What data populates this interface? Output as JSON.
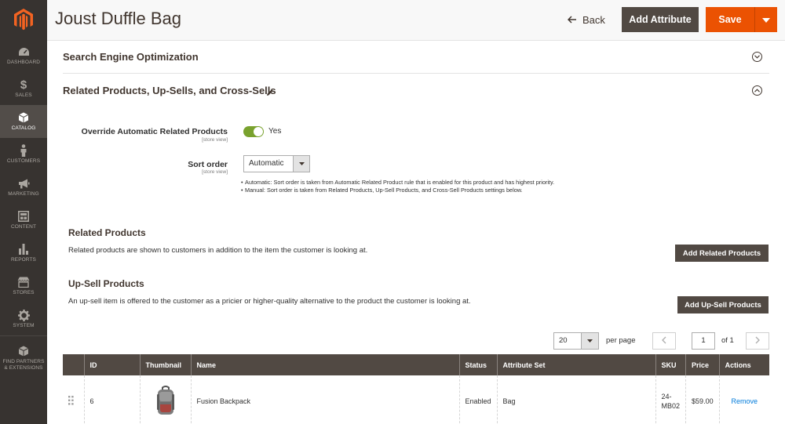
{
  "sidebar": {
    "items": [
      {
        "label": "DASHBOARD",
        "icon": "dashboard-icon"
      },
      {
        "label": "SALES",
        "icon": "dollar-icon"
      },
      {
        "label": "CATALOG",
        "icon": "cube-icon"
      },
      {
        "label": "CUSTOMERS",
        "icon": "person-icon"
      },
      {
        "label": "MARKETING",
        "icon": "megaphone-icon"
      },
      {
        "label": "CONTENT",
        "icon": "content-icon"
      },
      {
        "label": "REPORTS",
        "icon": "bar-chart-icon"
      },
      {
        "label": "STORES",
        "icon": "store-icon"
      },
      {
        "label": "SYSTEM",
        "icon": "gear-icon"
      },
      {
        "label": "FIND PARTNERS & EXTENSIONS",
        "icon": "extensions-icon"
      }
    ]
  },
  "header": {
    "title": "Joust Duffle Bag",
    "back_label": "Back",
    "add_attribute_label": "Add Attribute",
    "save_label": "Save"
  },
  "sections": {
    "seo_title": "Search Engine Optimization",
    "related_title": "Related Products, Up-Sells, and Cross-Sells"
  },
  "form": {
    "override_label": "Override Automatic Related Products",
    "override_scope": "[store view]",
    "override_value": "Yes",
    "sort_label": "Sort order",
    "sort_scope": "[store view]",
    "sort_value": "Automatic",
    "notes": [
      "Automatic: Sort order is taken from Automatic Related Product rule that is enabled for this product and has highest priority.",
      "Manual: Sort order is taken from Related Products, Up-Sell Products, and Cross-Sell Products settings below."
    ]
  },
  "related": {
    "title": "Related Products",
    "description": "Related products are shown to customers in addition to the item the customer is looking at.",
    "button_label": "Add Related Products"
  },
  "upsell": {
    "title": "Up-Sell Products",
    "description": "An up-sell item is offered to the customer as a pricier or higher-quality alternative to the product the customer is looking at.",
    "button_label": "Add Up-Sell Products"
  },
  "pager": {
    "per_page_value": "20",
    "per_page_label": "per page",
    "current_page": "1",
    "total_label": "of 1"
  },
  "grid": {
    "columns": [
      "",
      "ID",
      "Thumbnail",
      "Name",
      "Status",
      "Attribute Set",
      "SKU",
      "Price",
      "Actions"
    ],
    "rows": [
      {
        "id": "6",
        "name": "Fusion Backpack",
        "status": "Enabled",
        "attribute_set": "Bag",
        "sku": "24-MB02",
        "price": "$59.00",
        "action": "Remove"
      }
    ]
  },
  "colors": {
    "sidebar_bg": "#373330",
    "accent": "#eb5202",
    "dark_button": "#514943",
    "toggle_on": "#79a22e",
    "link": "#007bdb"
  }
}
